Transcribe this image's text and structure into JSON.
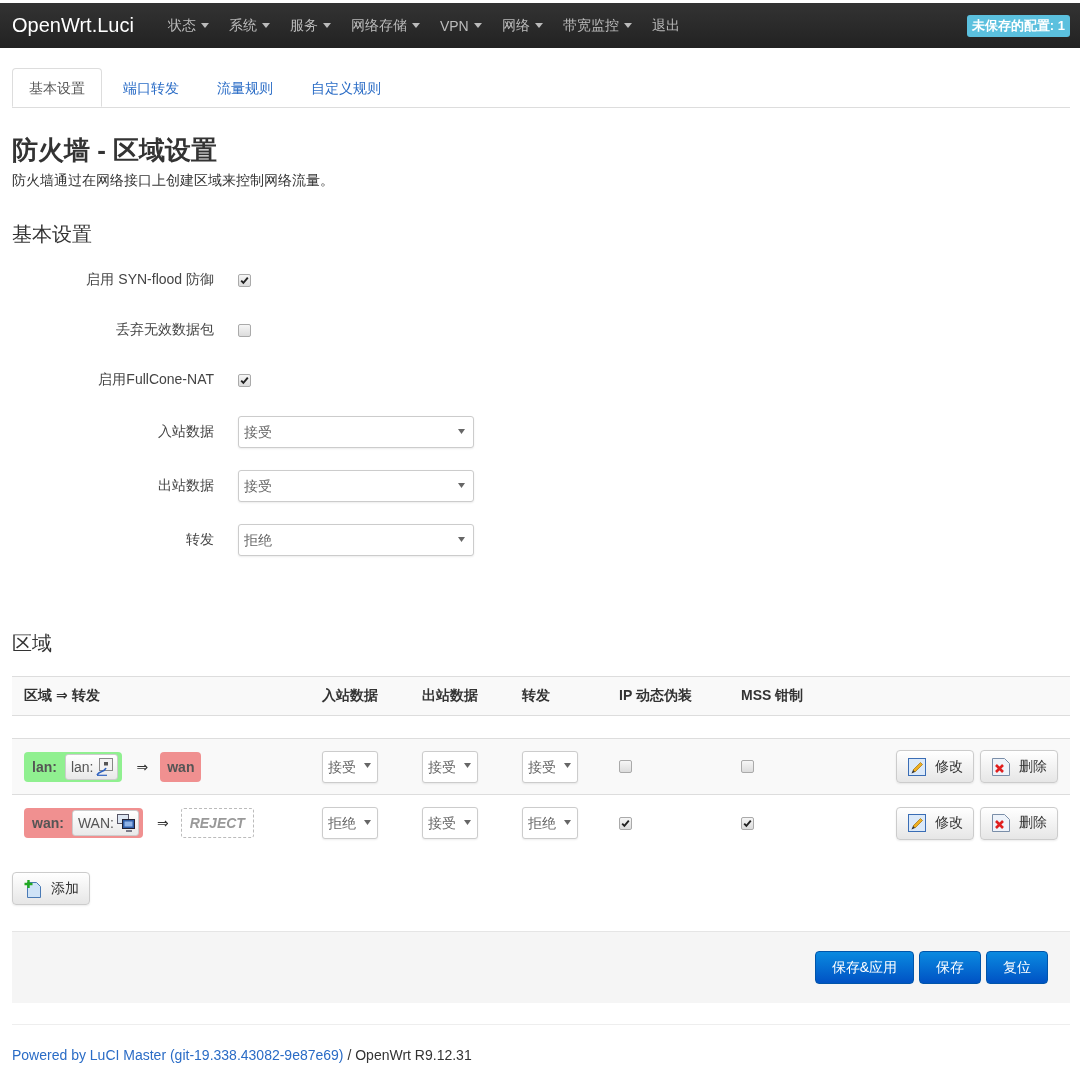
{
  "navbar": {
    "brand": "OpenWrt.Luci",
    "menu": [
      {
        "label": "状态",
        "dropdown": true
      },
      {
        "label": "系统",
        "dropdown": true
      },
      {
        "label": "服务",
        "dropdown": true
      },
      {
        "label": "网络存储",
        "dropdown": true
      },
      {
        "label": "VPN",
        "dropdown": true
      },
      {
        "label": "网络",
        "dropdown": true
      },
      {
        "label": "带宽监控",
        "dropdown": true
      },
      {
        "label": "退出",
        "dropdown": false
      }
    ],
    "badge": "未保存的配置: 1"
  },
  "tabs": [
    {
      "label": "基本设置",
      "selected": true
    },
    {
      "label": "端口转发",
      "selected": false
    },
    {
      "label": "流量规则",
      "selected": false
    },
    {
      "label": "自定义规则",
      "selected": false
    }
  ],
  "page": {
    "title": "防火墙 - 区域设置",
    "description": "防火墙通过在网络接口上创建区域来控制网络流量。"
  },
  "general": {
    "title": "基本设置",
    "fields": [
      {
        "kind": "checkbox",
        "label": "启用 SYN-flood 防御",
        "checked": true
      },
      {
        "kind": "checkbox",
        "label": "丢弃无效数据包",
        "checked": false
      },
      {
        "kind": "checkbox",
        "label": "启用FullCone-NAT",
        "checked": true
      },
      {
        "kind": "select",
        "label": "入站数据",
        "value": "接受"
      },
      {
        "kind": "select",
        "label": "出站数据",
        "value": "接受"
      },
      {
        "kind": "select",
        "label": "转发",
        "value": "拒绝"
      }
    ]
  },
  "zones": {
    "title": "区域",
    "columns": [
      "区域 ⇒ 转发",
      "入站数据",
      "出站数据",
      "转发",
      "IP 动态伪装",
      "MSS 钳制"
    ],
    "rows": [
      {
        "zone": {
          "name": "lan:",
          "color": "#90f090",
          "interface": {
            "label": "lan:",
            "kind": "ethernet"
          }
        },
        "arrow": "⇒",
        "forward": {
          "kind": "zone",
          "label": "wan",
          "color": "#f09090"
        },
        "input": "接受",
        "output": "接受",
        "forwarding": "接受",
        "masquerade": false,
        "mss_clamp": false,
        "buttons": [
          {
            "kind": "edit",
            "label": "修改"
          },
          {
            "kind": "delete",
            "label": "删除"
          }
        ]
      },
      {
        "zone": {
          "name": "wan:",
          "color": "#f09090",
          "interface": {
            "label": "WAN:",
            "kind": "switch"
          }
        },
        "arrow": "⇒",
        "forward": {
          "kind": "policy",
          "label": "REJECT"
        },
        "input": "拒绝",
        "output": "接受",
        "forwarding": "拒绝",
        "masquerade": true,
        "mss_clamp": true,
        "buttons": [
          {
            "kind": "edit",
            "label": "修改"
          },
          {
            "kind": "delete",
            "label": "删除"
          }
        ]
      }
    ]
  },
  "add_button": "添加",
  "actions": [
    "保存&应用",
    "保存",
    "复位"
  ],
  "footer": {
    "link": "Powered by LuCI Master (git-19.338.43082-9e87e69)",
    "text": "/ OpenWrt R9.12.31"
  }
}
